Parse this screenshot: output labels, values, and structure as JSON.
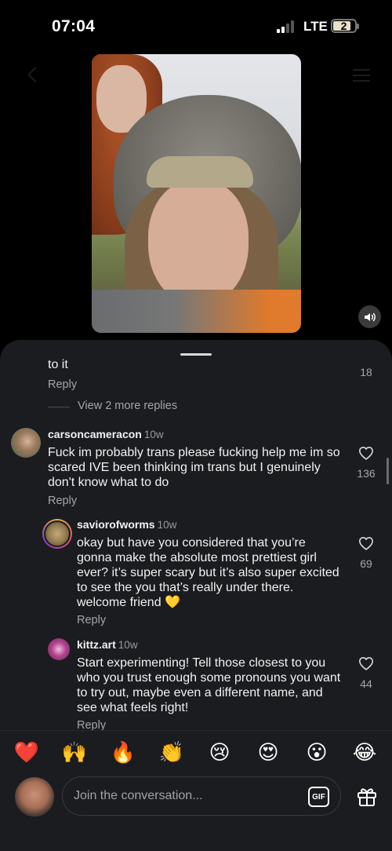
{
  "status_bar": {
    "time": "07:04",
    "network": "LTE",
    "battery": "2"
  },
  "video": {
    "sound_icon": "speaker-icon"
  },
  "comments": {
    "prev_tail": {
      "text": "to it",
      "reply_label": "Reply",
      "likes": "18"
    },
    "view_more": "View 2 more replies",
    "top": {
      "username": "carsoncameracon",
      "ago": "10w",
      "text": "Fuck im probably trans please fucking help me im so scared IVE been thinking im trans but I genuinely don't know what to do",
      "reply_label": "Reply",
      "likes": "136"
    },
    "replies": [
      {
        "username": "saviorofworms",
        "ago": "10w",
        "text": "okay but have you considered that you’re gonna make the absolute most prettiest girl ever? it’s super scary but it’s also super excited to see the you that’s really under there. welcome friend 💛",
        "reply_label": "Reply",
        "likes": "69"
      },
      {
        "username": "kittz.art",
        "ago": "10w",
        "text": "Start experimenting! Tell those closest to you who you trust enough some pronouns you want to try out, maybe even a different name, and see what feels right!",
        "reply_label": "Reply",
        "likes": "44"
      }
    ]
  },
  "emoji_bar": [
    "❤️",
    "🙌",
    "🔥",
    "👏",
    "😢",
    "😍",
    "😮",
    "😂"
  ],
  "composer": {
    "placeholder": "Join the conversation...",
    "gif_label": "GIF",
    "gift_icon": "gift-icon"
  },
  "colors": {
    "sheet_bg": "#1b1c1f",
    "text": "#f2f2f2",
    "muted": "#a5a5a8",
    "story_ring": "#e8a03a"
  }
}
